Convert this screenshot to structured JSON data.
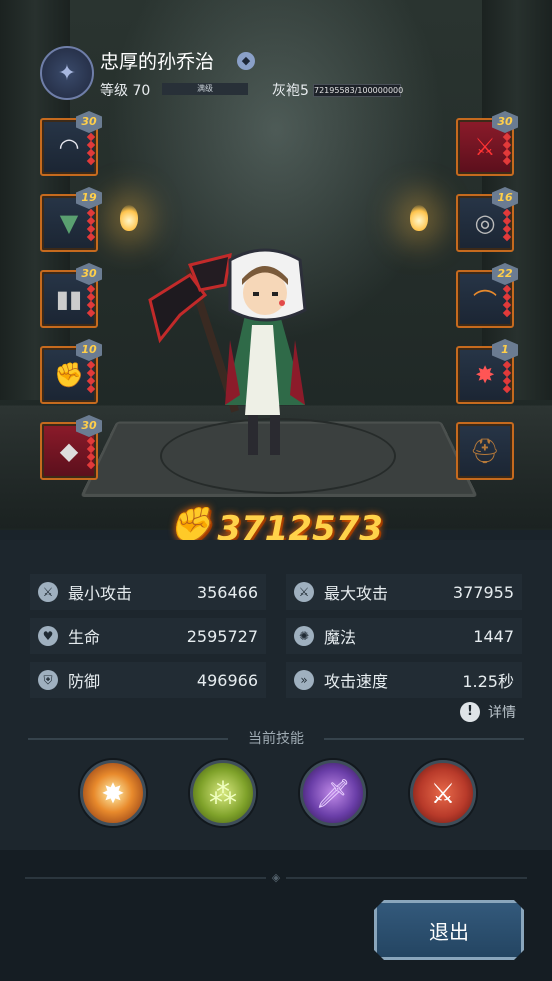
{
  "player": {
    "name": "忠厚的孙乔治",
    "level_label": "等级 70",
    "level_bar_text": "满级",
    "rank_label": "灰袍5",
    "rank_progress_text": "72195583/100000000",
    "emblem_icon": "shield-emblem-icon",
    "verify_icon": "badge-icon"
  },
  "equipment_left": [
    {
      "name": "hood",
      "icon": "hood-icon",
      "level": "30",
      "rarity": "blue"
    },
    {
      "name": "cloak",
      "icon": "cloak-icon",
      "level": "19",
      "rarity": "blue"
    },
    {
      "name": "boots",
      "icon": "boots-icon",
      "level": "30",
      "rarity": "blue"
    },
    {
      "name": "gauntlet",
      "icon": "gauntlet-icon",
      "level": "10",
      "rarity": "blue"
    },
    {
      "name": "belt",
      "icon": "belt-icon",
      "level": "30",
      "rarity": "red"
    }
  ],
  "equipment_right": [
    {
      "name": "weapon",
      "icon": "axe-icon",
      "level": "30",
      "rarity": "red"
    },
    {
      "name": "ring",
      "icon": "ring-icon",
      "level": "16",
      "rarity": "blue"
    },
    {
      "name": "amulet",
      "icon": "amulet-icon",
      "level": "22",
      "rarity": "blue"
    },
    {
      "name": "charm",
      "icon": "charm-icon",
      "level": "1",
      "rarity": "blue"
    },
    {
      "name": "helmet-empty",
      "icon": "helmet-icon",
      "level": "",
      "rarity": "blue"
    }
  ],
  "combat_power": "3712573",
  "stats": [
    {
      "icon": "sword-icon",
      "label": "最小攻击",
      "value": "356466"
    },
    {
      "icon": "sword-icon",
      "label": "最大攻击",
      "value": "377955"
    },
    {
      "icon": "heart-icon",
      "label": "生命",
      "value": "2595727"
    },
    {
      "icon": "magic-icon",
      "label": "魔法",
      "value": "1447"
    },
    {
      "icon": "shield-icon",
      "label": "防御",
      "value": "496966"
    },
    {
      "icon": "speed-icon",
      "label": "攻击速度",
      "value": "1.25秒"
    }
  ],
  "details_label": "详情",
  "skills_title": "当前技能",
  "skills": [
    {
      "icon": "explosion-icon",
      "color": "#e88a2c"
    },
    {
      "icon": "poison-orbs-icon",
      "color": "#7fa22a"
    },
    {
      "icon": "shadow-dagger-icon",
      "color": "#6a3ea8"
    },
    {
      "icon": "crossed-axes-icon",
      "color": "#b83a2a"
    }
  ],
  "exit_label": "退出",
  "colors": {
    "accent": "#ffd24a",
    "panel": "#1d262d",
    "slot_border": "#c66a1e"
  }
}
